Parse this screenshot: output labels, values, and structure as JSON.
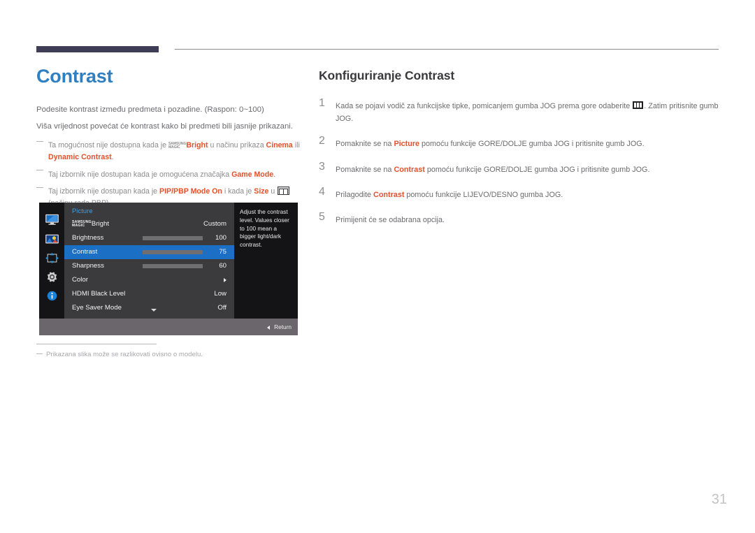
{
  "document": {
    "page_number": "31"
  },
  "left": {
    "title": "Contrast",
    "body_line_1": "Podesite kontrast između predmeta i pozadine. (Raspon: 0~100)",
    "body_line_2": "Viša vrijednost povećat će kontrast kako bi predmeti bili jasnije prikazani.",
    "notes": [
      {
        "t1": "Ta mogućnost nije dostupna kada je ",
        "magic_top": "SAMSUNG",
        "magic_bottom": "MAGIC",
        "hl1": "Bright",
        "t2": " u načinu prikaza ",
        "hl2": "Cinema",
        "t3": " ili ",
        "hl3": "Dynamic Contrast",
        "t4": "."
      },
      {
        "t1": "Taj izbornik nije dostupan kada je omogućena značajka ",
        "hl1": "Game Mode",
        "t2": "."
      },
      {
        "t1": "Taj izbornik nije dostupan kada je ",
        "hl1": "PIP/PBP Mode On",
        "t2": " i kada je ",
        "hl2": "Size",
        "t3": " u ",
        "icon": "pbp-size-icon",
        "t4": "(načinu rada PBP)."
      }
    ],
    "footnote": "Prikazana slika može se razlikovati ovisno o modelu."
  },
  "osd": {
    "icons": [
      {
        "name": "display-icon"
      },
      {
        "name": "picture-icon"
      },
      {
        "name": "pip-pbp-icon"
      },
      {
        "name": "system-gear-icon"
      },
      {
        "name": "information-icon"
      }
    ],
    "section_title": "Picture",
    "rows": [
      {
        "label_magic_top": "SAMSUNG",
        "label_magic_bottom": "MAGIC",
        "label": "Bright",
        "value": "Custom",
        "type": "magic",
        "selected": false
      },
      {
        "label": "Brightness",
        "value": "100",
        "type": "slider",
        "fill_percent": 100,
        "selected": false
      },
      {
        "label": "Contrast",
        "value": "75",
        "type": "slider",
        "fill_percent": 75,
        "selected": true
      },
      {
        "label": "Sharpness",
        "value": "60",
        "type": "slider",
        "fill_percent": 60,
        "selected": false
      },
      {
        "label": "Color",
        "value": "",
        "type": "submenu",
        "selected": false
      },
      {
        "label": "HDMI Black Level",
        "value": "Low",
        "type": "value",
        "selected": false
      },
      {
        "label": "Eye Saver Mode",
        "value": "Off",
        "type": "value",
        "selected": false
      }
    ],
    "description": "Adjust the contrast level. Values closer to 100 mean a bigger light/dark contrast.",
    "return_label": "Return",
    "colors": {
      "panel_bg": "#3b3b3d",
      "side_bg": "#141416",
      "highlight": "#1b6fc4",
      "bottom_bar": "#6b666b",
      "section_title": "#4a9ede"
    }
  },
  "right": {
    "title": "Konfiguriranje Contrast",
    "steps": [
      {
        "num": "1",
        "t1": "Kada se pojavi vodič za funkcijske tipke, pomicanjem gumba JOG prema gore odaberite ",
        "icon": "menu-bars-icon",
        "t2": ". Zatim pritisnite gumb JOG."
      },
      {
        "num": "2",
        "t1": "Pomaknite se na ",
        "hl1": "Picture",
        "t2": " pomoću funkcije GORE/DOLJE gumba JOG i pritisnite gumb JOG."
      },
      {
        "num": "3",
        "t1": "Pomaknite se na ",
        "hl1": "Contrast",
        "t2": " pomoću funkcije GORE/DOLJE gumba JOG i pritisnite gumb JOG."
      },
      {
        "num": "4",
        "t1": "Prilagodite ",
        "hl1": "Contrast",
        "t2": " pomoću funkcije LIJEVO/DESNO gumba JOG."
      },
      {
        "num": "5",
        "t1": "Primijenit će se odabrana opcija.",
        "hl1": "",
        "t2": ""
      }
    ]
  },
  "colors": {
    "accent_blue": "#2f7fc1",
    "highlight_orange": "#e4502b",
    "header_bar": "#3f3d56",
    "body_text": "#6b6b6e"
  }
}
